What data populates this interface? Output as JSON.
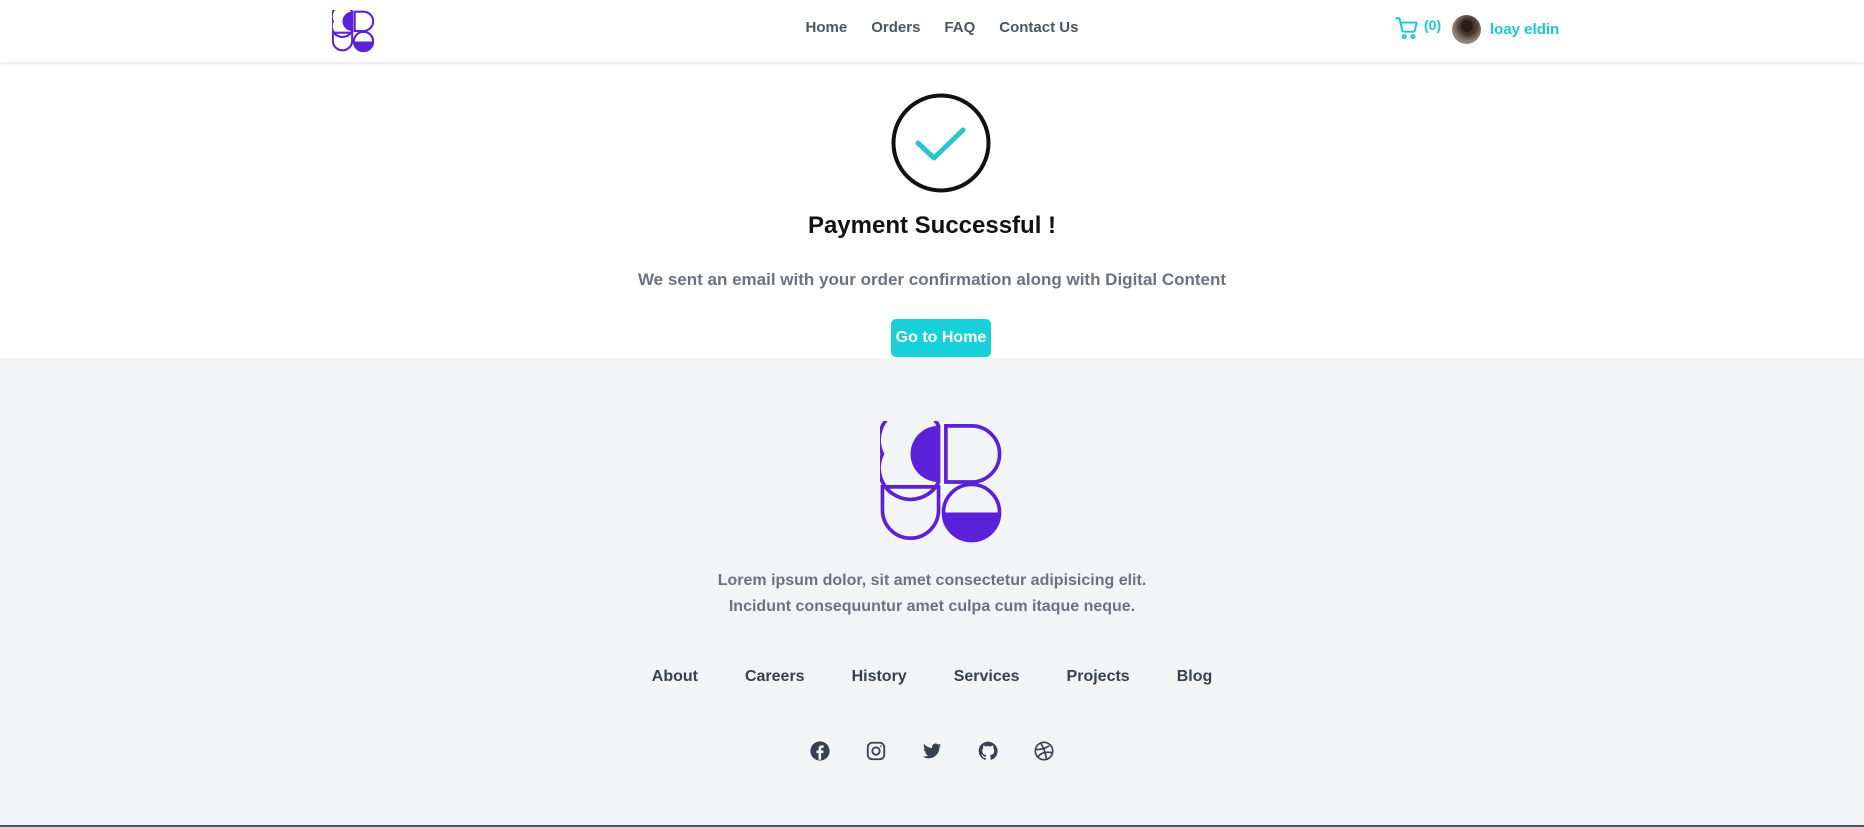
{
  "header": {
    "nav": [
      "Home",
      "Orders",
      "FAQ",
      "Contact Us"
    ],
    "cart_count": "(0)",
    "user_name": "loay eldin"
  },
  "main": {
    "title": "Payment Successful !",
    "subtitle": "We sent an email with your order confirmation along with Digital Content",
    "button_label": "Go to Home"
  },
  "footer": {
    "text_line1": "Lorem ipsum dolor, sit amet consectetur adipisicing elit.",
    "text_line2": "Incidunt consequuntur amet culpa cum itaque neque.",
    "links": [
      "About",
      "Careers",
      "History",
      "Services",
      "Projects",
      "Blog"
    ],
    "social_icons": [
      "facebook-icon",
      "instagram-icon",
      "twitter-icon",
      "github-icon",
      "dribbble-icon"
    ]
  },
  "colors": {
    "accent": "#16d1d8",
    "brand": "#5b21d9",
    "check": "#26c6c9"
  }
}
